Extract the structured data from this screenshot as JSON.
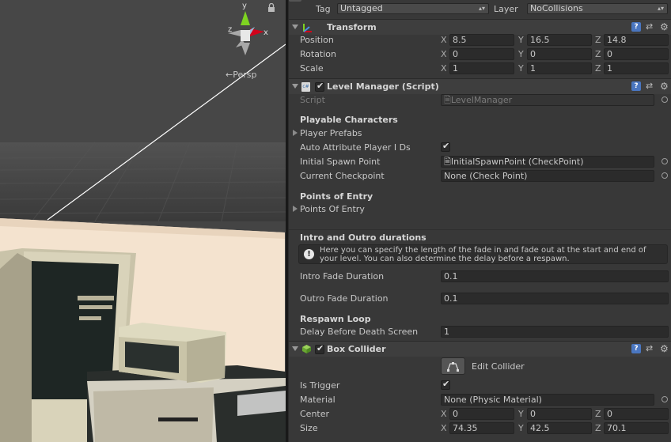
{
  "scene": {
    "gizmo_labels": {
      "y": "y",
      "x": "x",
      "z": "z"
    },
    "view_mode": "Persp"
  },
  "top_bar": {
    "tag_label": "Tag",
    "tag_value": "Untagged",
    "layer_label": "Layer",
    "layer_value": "NoCollisions"
  },
  "transform": {
    "title": "Transform",
    "position": {
      "label": "Position",
      "x": "8.5",
      "y": "16.5",
      "z": "14.8"
    },
    "rotation": {
      "label": "Rotation",
      "x": "0",
      "y": "0",
      "z": "0"
    },
    "scale": {
      "label": "Scale",
      "x": "1",
      "y": "1",
      "z": "1"
    }
  },
  "axes": {
    "x": "X",
    "y": "Y",
    "z": "Z"
  },
  "level_manager": {
    "title": "Level Manager (Script)",
    "script_label": "Script",
    "script_value": "LevelManager",
    "playable_header": "Playable Characters",
    "player_prefabs": "Player Prefabs",
    "auto_attribute_label": "Auto Attribute Player I Ds",
    "auto_attribute_checked": true,
    "initial_spawn_label": "Initial Spawn Point",
    "initial_spawn_value": "InitialSpawnPoint (CheckPoint)",
    "current_checkpoint_label": "Current Checkpoint",
    "current_checkpoint_value": "None (Check Point)",
    "points_header": "Points of Entry",
    "points_of_entry": "Points Of Entry",
    "intro_outro_header": "Intro and Outro durations",
    "help_text": "Here you can specify the length of the fade in and fade out at the start and end of your level. You can also determine the delay before a respawn.",
    "intro_label": "Intro Fade Duration",
    "intro_value": "0.1",
    "outro_label": "Outro Fade Duration",
    "outro_value": "0.1",
    "respawn_header": "Respawn Loop",
    "delay_label": "Delay Before Death Screen",
    "delay_value": "1"
  },
  "box_collider": {
    "title": "Box Collider",
    "edit_collider": "Edit Collider",
    "is_trigger_label": "Is Trigger",
    "is_trigger_checked": true,
    "material_label": "Material",
    "material_value": "None (Physic Material)",
    "center": {
      "label": "Center",
      "x": "0",
      "y": "0",
      "z": "0"
    },
    "size": {
      "label": "Size",
      "x": "74.35",
      "y": "42.5",
      "z": "70.1"
    }
  },
  "colors": {
    "scene_wall": "#f4e3cf",
    "scene_floor": "#3d3d3d",
    "gizmo_y": "#7ed321",
    "gizmo_x": "#d0021b",
    "help_button": "#4a76c0"
  }
}
